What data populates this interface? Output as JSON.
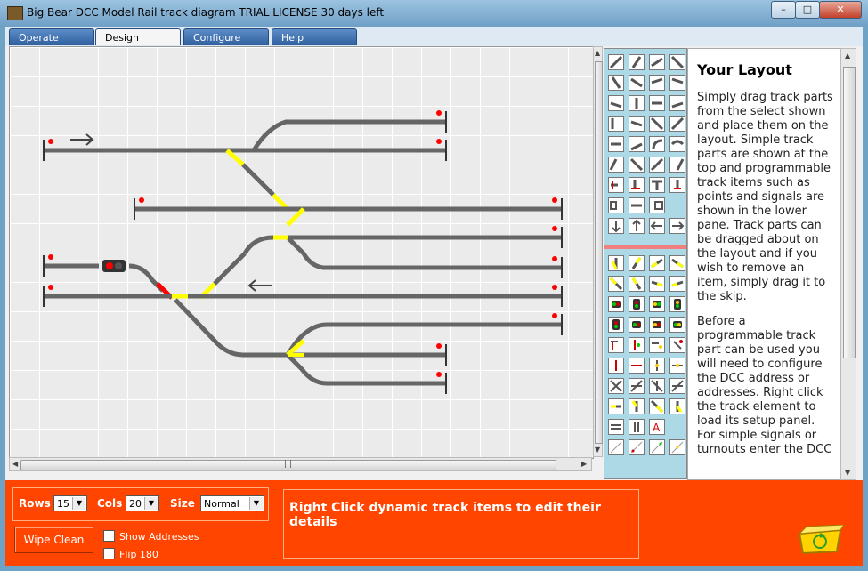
{
  "window": {
    "title": "Big Bear DCC Model Rail track diagram TRIAL LICENSE 30 days left",
    "minimize": "–",
    "maximize": "□",
    "close": "✕"
  },
  "tabs": [
    {
      "label": "Operate"
    },
    {
      "label": "Design",
      "active": true
    },
    {
      "label": "Configure"
    },
    {
      "label": "Help"
    }
  ],
  "info_panel": {
    "title": "Your Layout",
    "paragraph1": "Simply drag track parts from the select shown and place them on the layout. Simple track parts are shown at the top and programmable track items such as points and signals are shown in the lower pane. Track parts can be dragged about on the layout and if you wish to remove an item, simply drag it to the skip.",
    "paragraph2": "Before a programmable track part can be used you will need to configure the DCC address or addresses. Right click the track element to load its setup panel. For simple signals or turnouts enter the DCC"
  },
  "controls": {
    "rows_label": "Rows",
    "rows_value": "15",
    "cols_label": "Cols",
    "cols_value": "20",
    "size_label": "Size",
    "size_value": "Normal",
    "wipe_label": "Wipe Clean",
    "show_addresses_label": "Show Addresses",
    "show_addresses_checked": false,
    "flip_label": "Flip 180",
    "flip_checked": false
  },
  "message": "Right Click dynamic track items to edit their details",
  "colors": {
    "track": "#666666",
    "turnout_active": "#ffff00",
    "signal_danger": "#ff0000",
    "accent_bar": "#ff4500",
    "palette_bg": "#add8e6"
  },
  "icons": {
    "recycle_bin": "skip-icon"
  }
}
